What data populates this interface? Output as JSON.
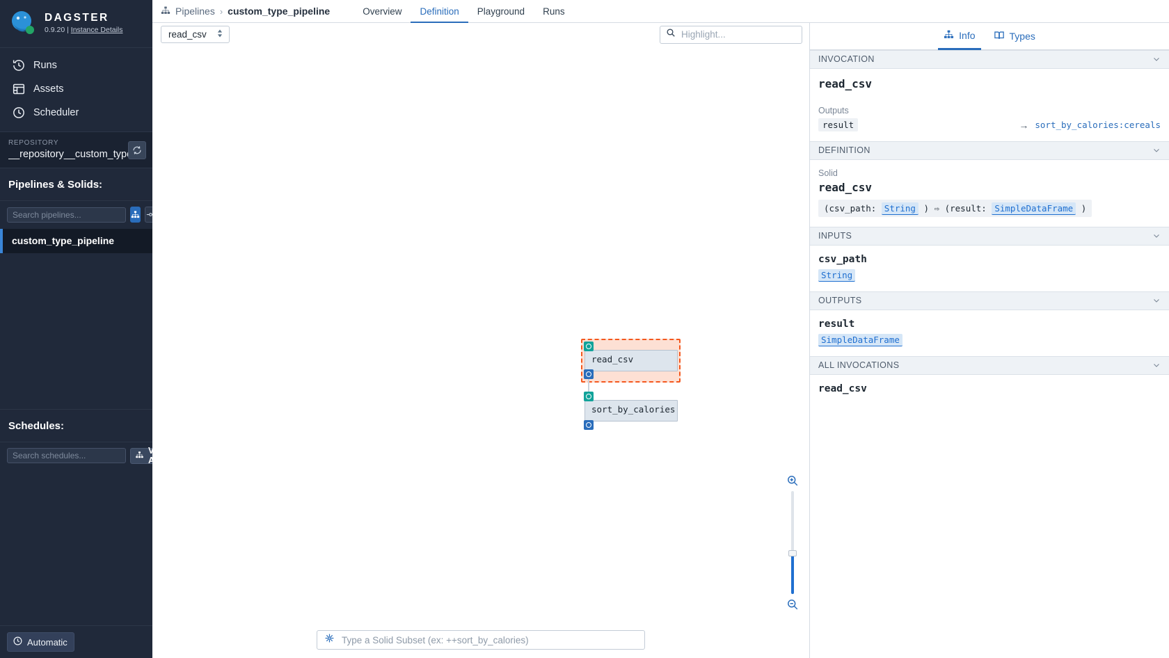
{
  "sidebar": {
    "brand": {
      "title": "DAGSTER",
      "version": "0.9.20",
      "separator": "|",
      "instance_link": "Instance Details"
    },
    "nav": [
      {
        "label": "Runs",
        "icon": "history-icon"
      },
      {
        "label": "Assets",
        "icon": "table-icon"
      },
      {
        "label": "Scheduler",
        "icon": "clock-icon"
      }
    ],
    "repository": {
      "label": "REPOSITORY",
      "name": "__repository__custom_type_pip",
      "reload_icon": "reload-icon"
    },
    "pipelines": {
      "heading": "Pipelines & Solids:",
      "search_placeholder": "Search pipelines...",
      "search_value": "",
      "toggle_graph_icon": "graph-icon",
      "toggle_solid_icon": "solid-icon",
      "items": [
        {
          "label": "custom_type_pipeline",
          "selected": true
        }
      ]
    },
    "schedules": {
      "heading": "Schedules:",
      "search_placeholder": "Search schedules...",
      "search_value": "",
      "view_all_label": "View All",
      "view_all_icon": "graph-icon"
    },
    "footer": {
      "label": "Automatic",
      "icon": "clock-icon"
    }
  },
  "topbar": {
    "breadcrumb": {
      "icon": "graph-icon",
      "root": "Pipelines",
      "separator": "›",
      "current": "custom_type_pipeline"
    },
    "tabs": [
      {
        "label": "Overview",
        "active": false
      },
      {
        "label": "Definition",
        "active": true
      },
      {
        "label": "Playground",
        "active": false
      },
      {
        "label": "Runs",
        "active": false
      }
    ]
  },
  "canvas": {
    "solid_select": {
      "value": "read_csv",
      "icon": "double-caret-icon"
    },
    "highlight": {
      "placeholder": "Highlight...",
      "value": "",
      "icon": "search-icon"
    },
    "subset": {
      "placeholder": "Type a Solid Subset (ex: ++sort_by_calories)",
      "value": "",
      "icon": "solid-subset-icon"
    },
    "zoom": {
      "in_icon": "zoom-in-icon",
      "out_icon": "zoom-out-icon",
      "level": 39
    },
    "nodes": [
      {
        "name": "read_csv",
        "selected": true,
        "inputs": 1,
        "outputs": 1
      },
      {
        "name": "sort_by_calories",
        "selected": false,
        "inputs": 1,
        "outputs": 1
      }
    ]
  },
  "rpanel": {
    "tabs": [
      {
        "label": "Info",
        "icon": "graph-icon",
        "active": true
      },
      {
        "label": "Types",
        "icon": "book-icon",
        "active": false
      }
    ],
    "invocation": {
      "section": "INVOCATION",
      "name": "read_csv",
      "outputs_label": "Outputs",
      "output_name": "result",
      "arrow": "→",
      "target": "sort_by_calories:cereals"
    },
    "definition": {
      "section": "DEFINITION",
      "solid_label": "Solid",
      "name": "read_csv",
      "sig_open": "(csv_path:",
      "sig_in_type": "String",
      "sig_mid": ") ⇨ (result:",
      "sig_out_type": "SimpleDataFrame",
      "sig_close": ")"
    },
    "inputs": {
      "section": "INPUTS",
      "items": [
        {
          "name": "csv_path",
          "type": "String"
        }
      ]
    },
    "outputs": {
      "section": "OUTPUTS",
      "items": [
        {
          "name": "result",
          "type": "SimpleDataFrame"
        }
      ]
    },
    "all_invocations": {
      "section": "ALL INVOCATIONS",
      "items": [
        {
          "name": "read_csv"
        }
      ]
    }
  },
  "colors": {
    "accent_blue": "#2a6dbb",
    "sidebar_bg": "#20293a",
    "selection_orange": "#f4581e",
    "node_fill": "#dde5ed",
    "port_in": "#12a39a",
    "port_out": "#2a6dbb"
  }
}
